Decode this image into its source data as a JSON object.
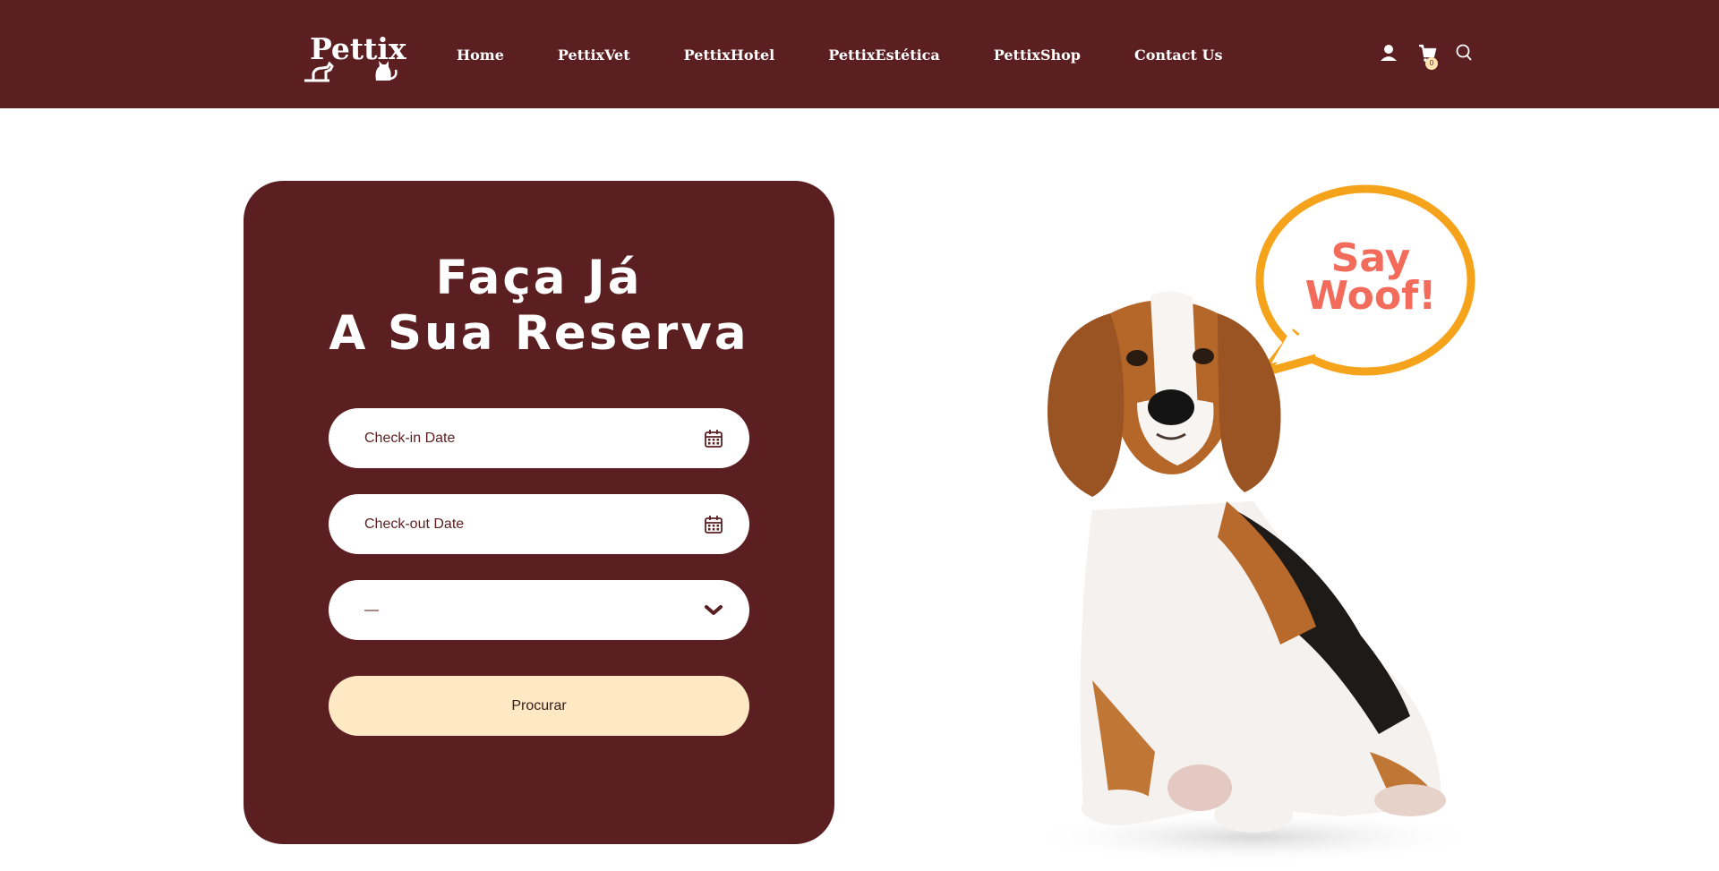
{
  "header": {
    "logo_text": "Pettix",
    "nav": [
      {
        "label": "Home"
      },
      {
        "label": "PettixVet"
      },
      {
        "label": "PettixHotel"
      },
      {
        "label": "PettixEstética"
      },
      {
        "label": "PettixShop"
      },
      {
        "label": "Contact Us"
      }
    ],
    "icons": [
      "user-icon",
      "cart-icon",
      "search-icon"
    ],
    "cart_count": "0"
  },
  "booking": {
    "title_line1": "Faça Já",
    "title_line2": "A Sua Reserva",
    "checkin_label": "Check-in Date",
    "checkout_label": "Check-out Date",
    "select_value": "—",
    "submit_label": "Procurar"
  },
  "hero": {
    "bubble_line1": "Say",
    "bubble_line2": "Woof!"
  },
  "colors": {
    "brand": "#5c1f21",
    "button": "#ffe9c4",
    "bubble_border": "#f5a31a",
    "bubble_text": "#f26b5b"
  }
}
